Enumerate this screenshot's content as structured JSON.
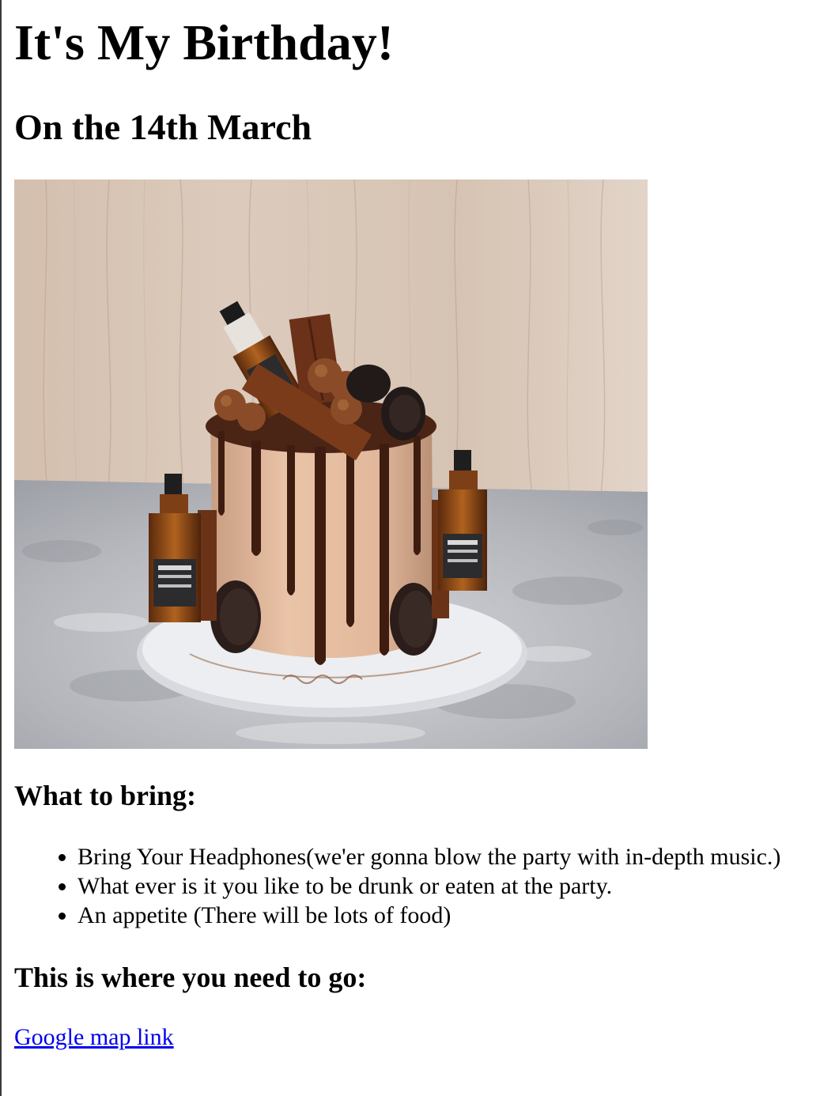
{
  "heading": "It's My Birthday!",
  "subheading": "On the 14th March",
  "photo": {
    "alt": "Cake",
    "colors": {
      "wood": "#d9c6b6",
      "marble": "#bcbec4",
      "frosting": "#e3b89c",
      "chocolate": "#4a2516",
      "whiskey": "#a0541c",
      "board": "#dcdee2"
    }
  },
  "bring_section": {
    "title": "What to bring:",
    "items": [
      "Bring Your Headphones(we'er gonna blow the party with in-depth music.)",
      "What ever is it you like to be drunk or eaten at the party.",
      "An appetite (There will be lots of food)"
    ]
  },
  "where_section": {
    "title": "This is where you need to go:",
    "link_text": "Google map link",
    "link_color": "#0000ee"
  }
}
